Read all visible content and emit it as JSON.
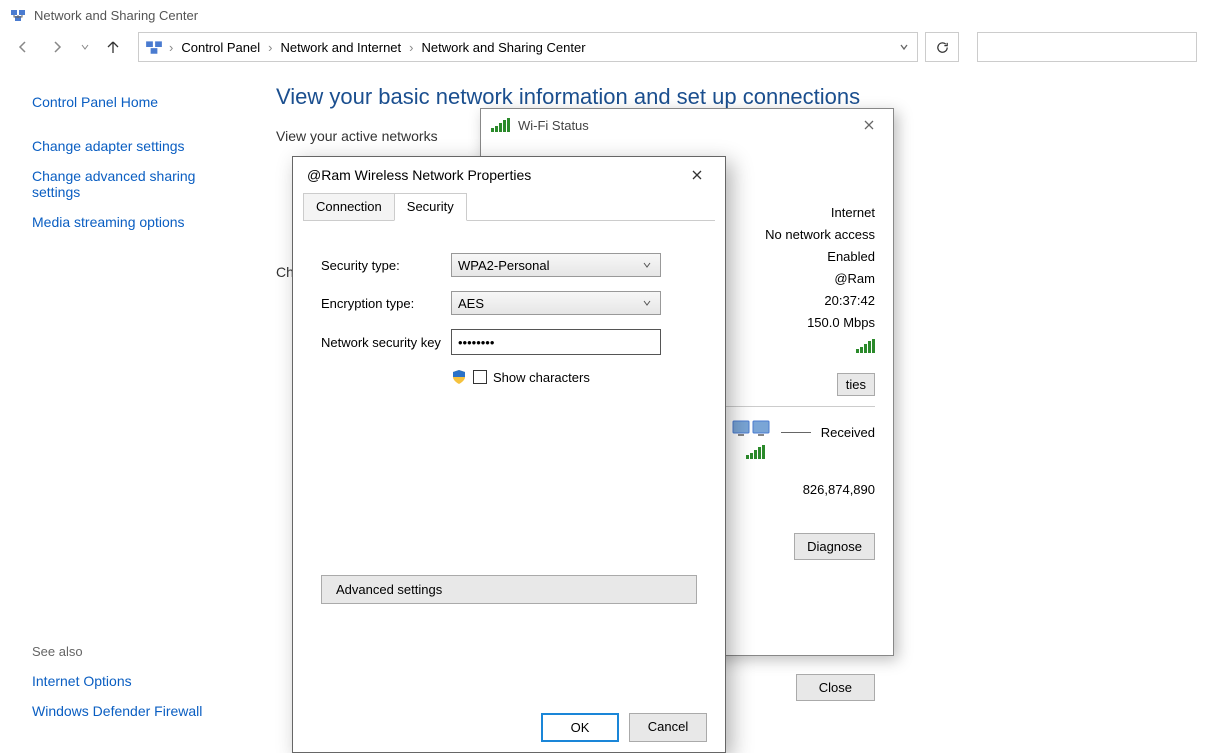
{
  "app_title": "Network and Sharing Center",
  "breadcrumb": {
    "root": "Control Panel",
    "mid": "Network and Internet",
    "leaf": "Network and Sharing Center"
  },
  "sidebar": {
    "home": "Control Panel Home",
    "links": {
      "adapter": "Change adapter settings",
      "advanced": "Change advanced sharing settings",
      "media": "Media streaming options"
    }
  },
  "see_also": {
    "heading": "See also",
    "links": {
      "inet": "Internet Options",
      "firewall": "Windows Defender Firewall"
    }
  },
  "main": {
    "title": "View your basic network information and set up connections",
    "active_label": "View your active networks",
    "change_prefix": "Ch"
  },
  "wifi_status": {
    "title": "Wi-Fi Status",
    "rows": {
      "internet": "Internet",
      "no_access": "No network access",
      "enabled": "Enabled",
      "ssid": "@Ram",
      "duration": "20:37:42",
      "speed": "150.0 Mbps"
    },
    "properties_fragment": "ties",
    "received_label": "Received",
    "bytes_received": "826,874,890",
    "diagnose": "Diagnose",
    "close": "Close"
  },
  "props_dialog": {
    "title": "@Ram Wireless Network Properties",
    "tabs": {
      "connection": "Connection",
      "security": "Security"
    },
    "fields": {
      "security_type_label": "Security type:",
      "security_type_value": "WPA2-Personal",
      "encryption_type_label": "Encryption type:",
      "encryption_type_value": "AES",
      "key_label": "Network security key",
      "key_value": "••••••••",
      "show_characters": "Show characters"
    },
    "advanced": "Advanced settings",
    "ok": "OK",
    "cancel": "Cancel"
  }
}
